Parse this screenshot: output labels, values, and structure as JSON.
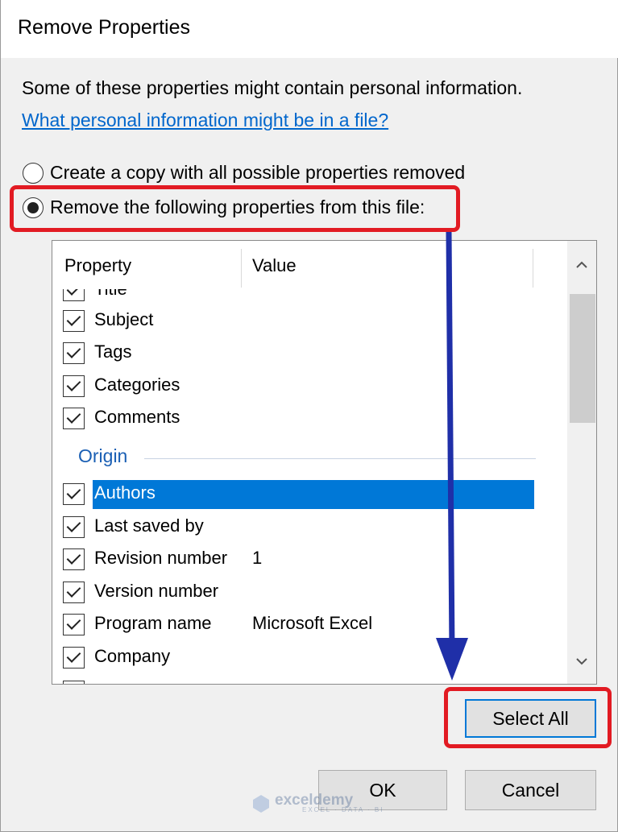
{
  "dialog": {
    "title": "Remove Properties",
    "info_text": "Some of these properties might contain personal information.",
    "info_link": "What personal information might be in a file?"
  },
  "options": [
    {
      "label": "Create a copy with all possible properties removed",
      "selected": false
    },
    {
      "label": "Remove the following properties from this file:",
      "selected": true
    }
  ],
  "list": {
    "headers": {
      "property": "Property",
      "value": "Value"
    },
    "partial_top_row": "Title",
    "rows_top": [
      {
        "label": "Subject",
        "value": ""
      },
      {
        "label": "Tags",
        "value": ""
      },
      {
        "label": "Categories",
        "value": ""
      },
      {
        "label": "Comments",
        "value": ""
      }
    ],
    "group_origin": "Origin",
    "rows_origin": [
      {
        "label": "Authors",
        "value": "",
        "selected": true
      },
      {
        "label": "Last saved by",
        "value": ""
      },
      {
        "label": "Revision number",
        "value": "1"
      },
      {
        "label": "Version number",
        "value": ""
      },
      {
        "label": "Program name",
        "value": "Microsoft Excel"
      },
      {
        "label": "Company",
        "value": ""
      }
    ]
  },
  "buttons": {
    "select_all": "Select All",
    "ok": "OK",
    "cancel": "Cancel"
  },
  "watermark": {
    "name": "exceldemy",
    "tagline": "EXCEL · DATA · BI"
  },
  "colors": {
    "highlight": "#e21b23",
    "arrow": "#1f2fa8",
    "selection": "#0078d7",
    "link": "#0066cc"
  }
}
